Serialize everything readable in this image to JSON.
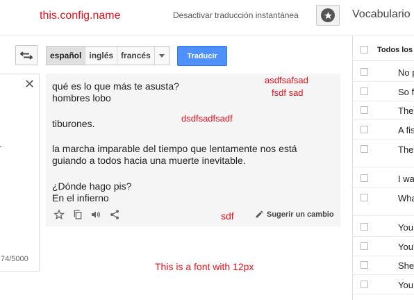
{
  "header": {
    "config_name": "this.config.name",
    "instant_link": "Desactivar traducción instantánea",
    "vocab_label": "Vocabulario"
  },
  "toolbar": {
    "languages": [
      "español",
      "inglés",
      "francés"
    ],
    "selected_language": "español",
    "translate_label": "Traducir"
  },
  "source": {
    "char_count": "74/5000"
  },
  "result": {
    "lines": {
      "l1": "qué es lo que más te asusta?",
      "l2": "hombres lobo",
      "l3": "tiburones.",
      "l4": "la marcha imparable del tiempo que lentamente nos está",
      "l5": "guiando a todos hacia una muerte inevitable.",
      "l6": "¿Dónde hago pis?",
      "l7": "En el infierno"
    },
    "suggest_label": "Sugerir un cambio"
  },
  "annotations": {
    "a1": "asdfsafsad",
    "a2": "fsdf sad",
    "a3": "dsdfsadfsadf",
    "a4": "sdf",
    "font_note": "This is a font with 12px"
  },
  "phrasebook": {
    "header": "Todos los",
    "rows": [
      "No p",
      "So f",
      "The",
      "A fis",
      "The",
      "I wa",
      "Wha",
      "You",
      "You'",
      "She",
      "You"
    ]
  },
  "colors": {
    "accent": "#4d90fe",
    "annotation": "#e8101c"
  }
}
